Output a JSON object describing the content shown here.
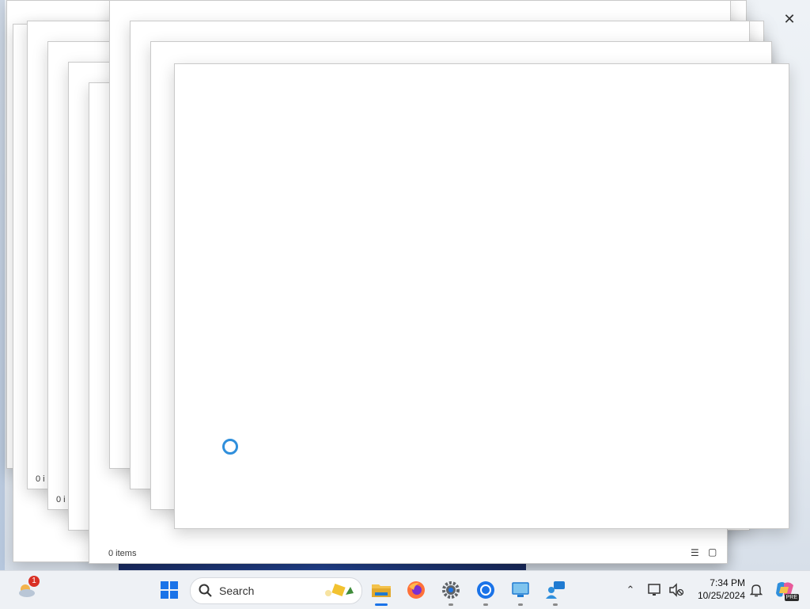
{
  "desktop": {
    "stacked_windows_status": [
      "0 i",
      "0 i",
      "0 items"
    ]
  },
  "taskbar": {
    "weather_badge": "1",
    "search_placeholder": "Search",
    "clock_time": "7:34 PM",
    "clock_date": "10/25/2024",
    "copilot_badge": "PRE",
    "apps": [
      {
        "name": "start",
        "icon": "windows-logo-icon"
      },
      {
        "name": "file-explorer",
        "icon": "folder-icon",
        "active": true
      },
      {
        "name": "firefox",
        "icon": "firefox-icon"
      },
      {
        "name": "settings",
        "icon": "gear-icon"
      },
      {
        "name": "chrome",
        "icon": "chrome-icon"
      },
      {
        "name": "remote-desktop",
        "icon": "monitor-icon"
      },
      {
        "name": "feedback-hub",
        "icon": "chat-person-icon"
      }
    ]
  },
  "colors": {
    "accent": "#1a73e8",
    "spinner": "#2f8fdc",
    "window_bg": "#ffffff"
  }
}
